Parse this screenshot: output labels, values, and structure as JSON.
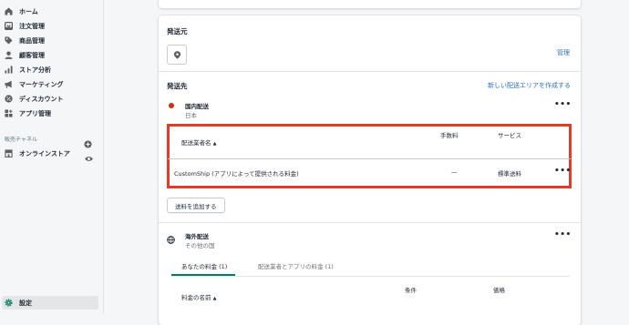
{
  "sidebar": {
    "items": [
      {
        "label": "ホーム",
        "icon": "home-icon"
      },
      {
        "label": "注文管理",
        "icon": "orders-icon"
      },
      {
        "label": "商品管理",
        "icon": "tag-icon"
      },
      {
        "label": "顧客管理",
        "icon": "person-icon"
      },
      {
        "label": "ストア分析",
        "icon": "analytics-icon"
      },
      {
        "label": "マーケティング",
        "icon": "megaphone-icon"
      },
      {
        "label": "ディスカウント",
        "icon": "discount-icon"
      },
      {
        "label": "アプリ管理",
        "icon": "apps-icon"
      }
    ],
    "channels_label": "販売チャネル",
    "online_store": "オンラインストア",
    "settings": "設定"
  },
  "origin": {
    "title": "発送元",
    "manage_link": "管理"
  },
  "destination": {
    "title": "発送先",
    "create_zone_link": "新しい配送エリアを作成する",
    "domestic": {
      "name": "国内配送",
      "country": "日本",
      "table": {
        "col_carrier": "配送業者名",
        "col_fee": "手数料",
        "col_service": "サービス",
        "row": {
          "carrier": "CustomShip (アプリによって提供される料金)",
          "fee": "—",
          "service": "標準送料"
        }
      },
      "add_rate_button": "送料を追加する"
    },
    "international": {
      "name": "海外配送",
      "region": "その他の国",
      "tabs": [
        "あなたの料金 (1)",
        "配送業者とアプリの料金 (1)"
      ],
      "table": {
        "col_rate_name": "料金の名前",
        "col_condition": "条件",
        "col_price": "価格"
      }
    }
  },
  "colors": {
    "highlight": "#e53b26",
    "link": "#2c6ecb",
    "active_tab": "#008060",
    "status_dot": "#d72c0d"
  }
}
